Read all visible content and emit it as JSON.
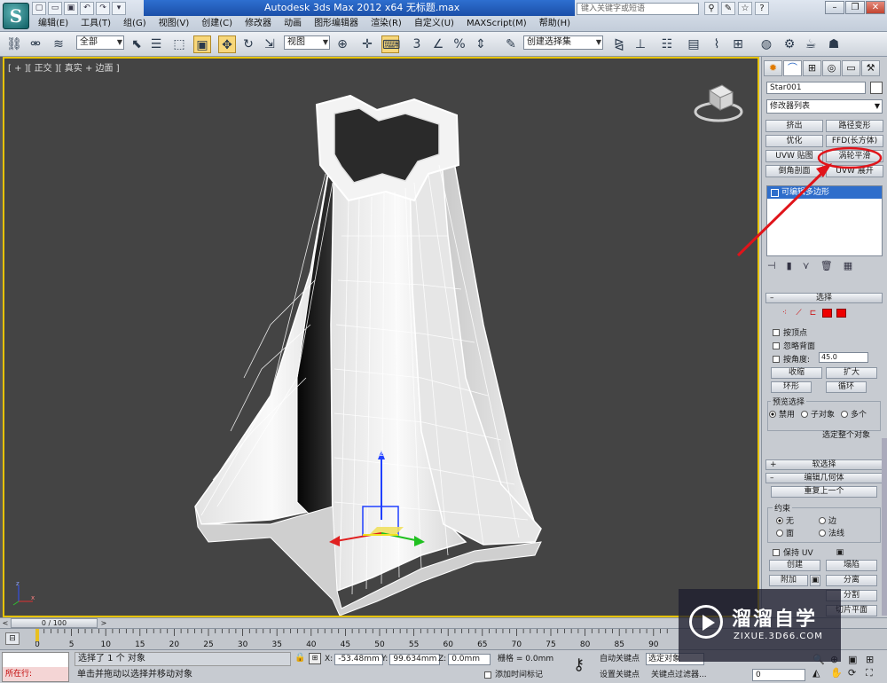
{
  "title_bar": {
    "app_logo": "S",
    "title": "Autodesk 3ds Max  2012 x64      无标题.max",
    "search_placeholder": "键入关键字或短语",
    "quick_access_icons": [
      "new-icon",
      "open-icon",
      "save-icon",
      "undo-icon",
      "redo-icon",
      "dropdown-icon"
    ],
    "help_icons": [
      "binoculars-icon",
      "tools-icon",
      "star-icon",
      "help-icon"
    ],
    "window_controls": [
      "minimize-icon",
      "restore-icon",
      "close-icon"
    ]
  },
  "menu": [
    "编辑(E)",
    "工具(T)",
    "组(G)",
    "视图(V)",
    "创建(C)",
    "修改器",
    "动画",
    "图形编辑器",
    "渲染(R)",
    "自定义(U)",
    "MAXScript(M)",
    "帮助(H)"
  ],
  "toolbar": {
    "selection_filter": "全部",
    "reference_coord": "视图",
    "named_selection": "创建选择集",
    "snap_labels": [
      "3",
      "%"
    ]
  },
  "viewport": {
    "label": "[ + ][ 正交 ][ 真实 + 边面 ]",
    "gizmo_axis_label": "z",
    "tripod_labels": [
      "z",
      "x"
    ]
  },
  "command_panel": {
    "tabs": [
      "create-tab",
      "modify-tab",
      "hierarchy-tab",
      "motion-tab",
      "display-tab",
      "utilities-tab"
    ],
    "object_name": "Star001",
    "modifier_list": "修改器列表",
    "modifier_buttons": [
      "挤出",
      "路径变形",
      "优化",
      "FFD(长方体)",
      "UVW 贴图",
      "涡轮平滑",
      "倒角剖面",
      "UVW 展开"
    ],
    "stack_item": "可编辑多边形",
    "selection_rollout": {
      "title": "选择",
      "by_vertex": "按顶点",
      "ignore_backfacing": "忽略背面",
      "by_angle": "按角度:",
      "angle_value": "45.0",
      "shrink": "收缩",
      "grow": "扩大",
      "ring": "环形",
      "loop": "循环",
      "preview_title": "预览选择",
      "preview_options": [
        "禁用",
        "子对象",
        "多个"
      ],
      "whole_object": "选定整个对象"
    },
    "soft_selection_title": "软选择",
    "edit_geometry": {
      "title": "编辑几何体",
      "repeat_last": "重复上一个",
      "constraints_title": "约束",
      "constraint_options": [
        "无",
        "边",
        "面",
        "法线"
      ],
      "preserve_uv": "保持 UV",
      "create": "创建",
      "collapse": "塌陷",
      "attach": "附加",
      "detach": "分离",
      "slice_plane": "切片平面",
      "split": "分割",
      "cut": "切割"
    }
  },
  "timeline": {
    "frame_display": "0 / 100",
    "ticks": [
      0,
      5,
      10,
      15,
      20,
      25,
      30,
      35,
      40,
      45,
      50,
      55,
      60,
      65,
      70,
      75,
      80,
      85,
      90
    ]
  },
  "status": {
    "maxscript_label": "所在行:",
    "selection_status": "选择了 1 个 对象",
    "prompt": "单击并拖动以选择并移动对象",
    "x_label": "X:",
    "x_value": "-53.48mm",
    "y_label": "Y:",
    "y_value": "99.634mm",
    "z_label": "Z:",
    "z_value": "0.0mm",
    "grid": "栅格 = 0.0mm",
    "add_time_tag": "添加时间标记",
    "auto_key": "自动关键点",
    "set_key": "设置关键点",
    "selected_dropdown": "选定对象",
    "key_filters": "关键点过滤器...",
    "frame_value": "0"
  },
  "watermark": {
    "title": "溜溜自学",
    "url": "ZIXUE.3D66.COM"
  },
  "colors": {
    "viewport_bg": "#444444",
    "viewport_border": "#e7c300",
    "selection_blue": "#2f6ecb",
    "annotation_red": "#e0141a",
    "title_blue": "#1b4fa8"
  }
}
